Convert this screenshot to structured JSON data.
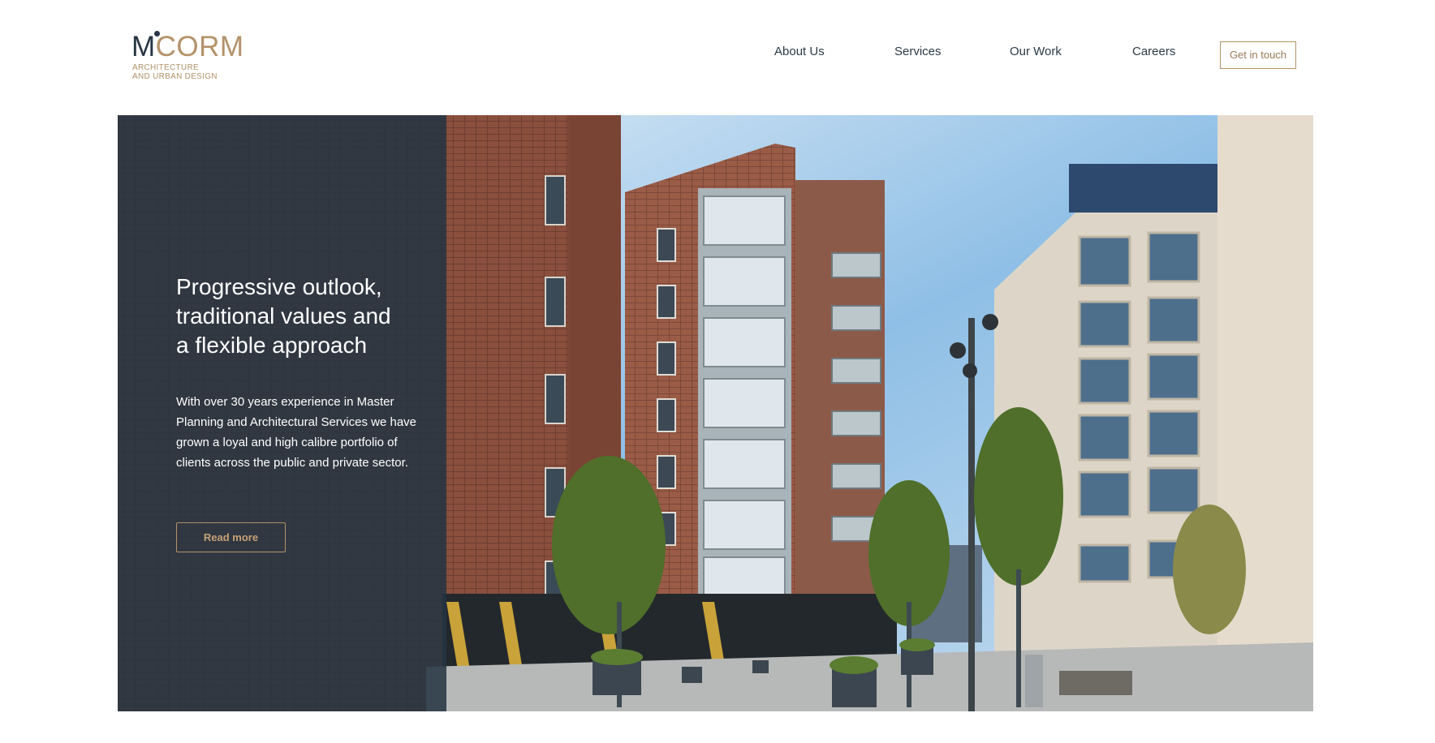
{
  "logo": {
    "initial": "M",
    "wordmark": "CORM",
    "tagline_line1": "ARCHITECTURE",
    "tagline_line2": "AND URBAN DESIGN"
  },
  "nav": {
    "items": [
      "About Us",
      "Services",
      "Our Work",
      "Careers"
    ],
    "cta_label": "Get in touch"
  },
  "hero": {
    "headline_line1": "Progressive outlook,",
    "headline_line2": "traditional values and",
    "headline_line3": "a flexible approach",
    "body": "With over 30 years experience in Master Planning and Architectural Services we have grown a loyal and high calibre portfolio of clients across the public and private sector.",
    "read_more_label": "Read more"
  },
  "colors": {
    "brand_navy": "#273645",
    "brand_gold": "#b49269",
    "panel_overlay": "#243442"
  }
}
